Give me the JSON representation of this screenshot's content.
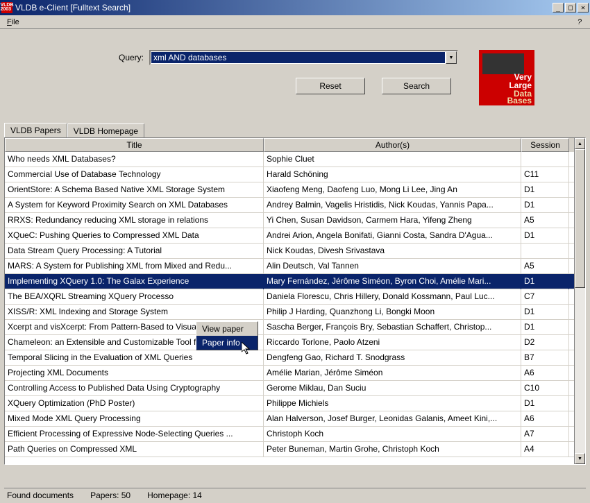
{
  "window": {
    "title": "VLDB e-Client [Fulltext Search]",
    "icon_label": "VLDB"
  },
  "menubar": {
    "file": "File",
    "help": "?"
  },
  "query": {
    "label": "Query:",
    "value": "xml AND databases",
    "reset": "Reset",
    "search": "Search"
  },
  "logo": {
    "line1": "Very",
    "line2": "Large",
    "line3": "Data",
    "line4": "Bases"
  },
  "tabs": {
    "papers": "VLDB Papers",
    "homepage": "VLDB Homepage"
  },
  "columns": {
    "title": "Title",
    "authors": "Author(s)",
    "session": "Session"
  },
  "rows": [
    {
      "title": "Who needs XML Databases?",
      "authors": "Sophie Cluet",
      "session": ""
    },
    {
      "title": "Commercial Use of Database Technology",
      "authors": "Harald Schöning",
      "session": "C11"
    },
    {
      "title": "OrientStore: A Schema Based Native XML Storage System",
      "authors": "Xiaofeng  Meng, Daofeng Luo, Mong Li Lee, Jing An",
      "session": "D1"
    },
    {
      "title": "A System for Keyword Proximity Search on XML Databases",
      "authors": "Andrey Balmin, Vagelis Hristidis,  Nick Koudas, Yannis Papa...",
      "session": "D1"
    },
    {
      "title": "RRXS: Redundancy reducing XML storage in relations",
      "authors": "Yi Chen, Susan Davidson, Carmem Hara, Yifeng Zheng",
      "session": "A5"
    },
    {
      "title": "XQueC: Pushing Queries to Compressed XML Data",
      "authors": "Andrei Arion, Angela Bonifati, Gianni Costa, Sandra D'Agua...",
      "session": "D1"
    },
    {
      "title": "Data Stream Query Processing: A Tutorial",
      "authors": "Nick Koudas, Divesh Srivastava",
      "session": ""
    },
    {
      "title": "MARS: A System for Publishing XML from Mixed and Redu...",
      "authors": "Alin Deutsch, Val Tannen",
      "session": "A5"
    },
    {
      "title": "Implementing XQuery 1.0: The Galax Experience",
      "authors": "Mary Fernández, Jérôme Siméon, Byron Choi, Amélie Mari...",
      "session": "D1"
    },
    {
      "title": "The BEA/XQRL Streaming XQuery Processo",
      "authors": "Daniela Florescu, Chris Hillery, Donald Kossmann, Paul Luc...",
      "session": "C7"
    },
    {
      "title": "XISS/R: XML Indexing and Storage System",
      "authors": "Philip J Harding, Quanzhong Li, Bongki Moon",
      "session": "D1"
    },
    {
      "title": "Xcerpt and visXcerpt: From Pattern-Based to Visual Query...",
      "authors": "Sascha Berger, François Bry, Sebastian Schaffert, Christop...",
      "session": "D1"
    },
    {
      "title": "Chameleon: an Extensible and Customizable Tool for Web...",
      "authors": "Riccardo Torlone, Paolo Atzeni",
      "session": "D2"
    },
    {
      "title": "Temporal Slicing in the Evaluation of XML Queries",
      "authors": "Dengfeng Gao, Richard T. Snodgrass",
      "session": "B7"
    },
    {
      "title": "Projecting XML Documents",
      "authors": "Amélie Marian, Jérôme Siméon",
      "session": "A6"
    },
    {
      "title": "Controlling Access to Published Data Using Cryptography",
      "authors": "Gerome Miklau, Dan Suciu",
      "session": "C10"
    },
    {
      "title": "XQuery Optimization (PhD Poster)",
      "authors": "Philippe Michiels",
      "session": "D1"
    },
    {
      "title": "Mixed Mode XML Query Processing",
      "authors": "Alan Halverson, Josef Burger, Leonidas Galanis, Ameet Kini,...",
      "session": "A6"
    },
    {
      "title": "Efficient Processing of Expressive Node-Selecting Queries ...",
      "authors": "Christoph Koch",
      "session": "A7"
    },
    {
      "title": "Path Queries on Compressed XML",
      "authors": "Peter Buneman, Martin Grohe, Christoph Koch",
      "session": "A4"
    }
  ],
  "selected_row_index": 8,
  "context_menu": {
    "view_paper": "View paper",
    "paper_info": "Paper info"
  },
  "status": {
    "found": "Found documents",
    "papers": "Papers: 50",
    "homepage": "Homepage: 14"
  }
}
